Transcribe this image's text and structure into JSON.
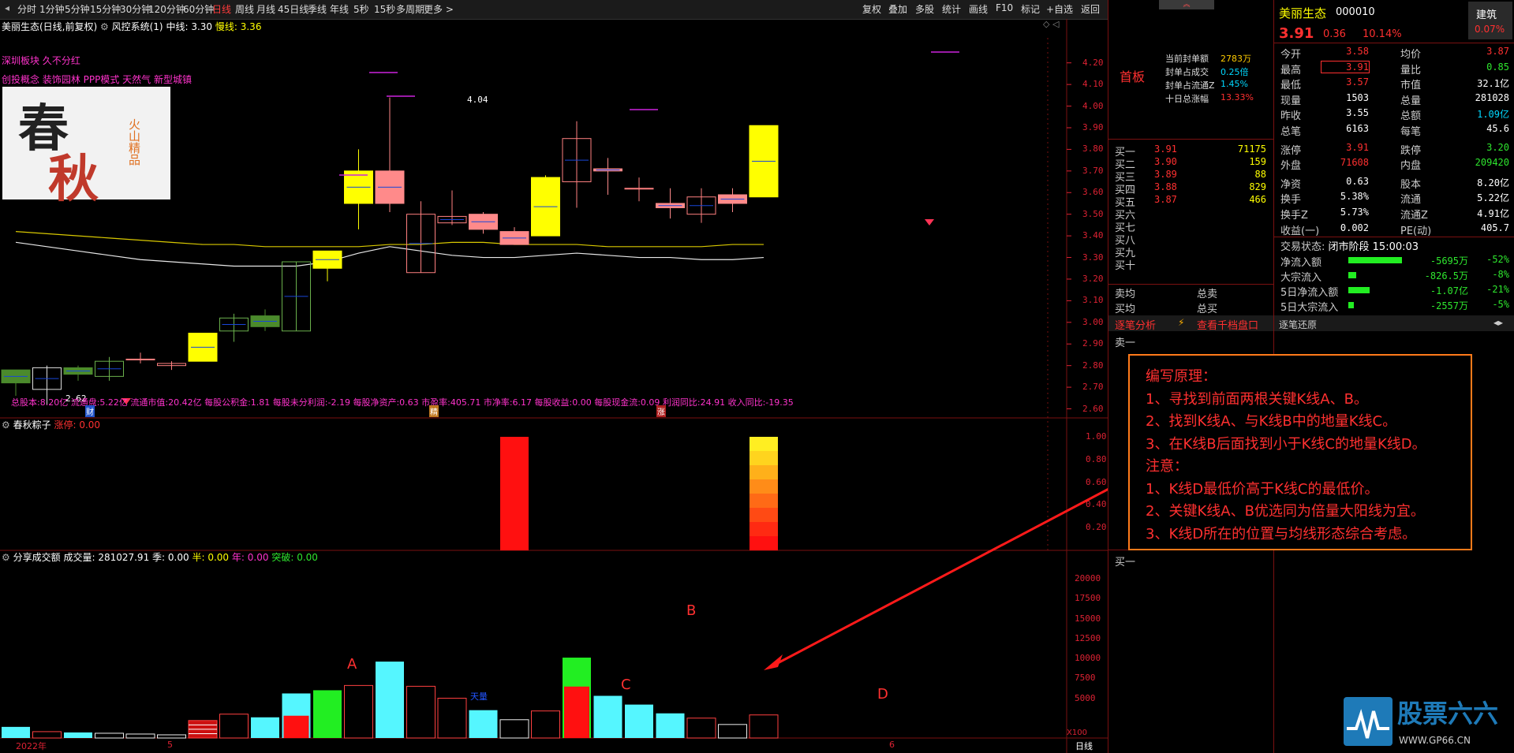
{
  "toolbar": {
    "periods": [
      "分时",
      "1分钟",
      "5分钟",
      "15分钟",
      "30分钟",
      "120分钟",
      "60分钟",
      "日线",
      "周线",
      "月线",
      "45日线",
      "季线",
      "年线",
      "5秒",
      "15秒",
      "多周期",
      "更多 >"
    ],
    "active_period": "日线",
    "right_buttons": [
      "复权",
      "叠加",
      "多股",
      "统计",
      "画线",
      "F10",
      "标记",
      "+自选",
      "返回"
    ]
  },
  "chart": {
    "title": "美丽生态(日线,前复权)",
    "indicator": "风控系统(1)",
    "mid_label": "中线:",
    "mid_value": "3.30",
    "slow_label": "慢线:",
    "slow_value": "3.36",
    "tags_line1": "深圳板块  久不分红",
    "tags_line2": "创投概念  装饰园林  PPP模式  天然气  新型城镇",
    "logo_text_1": "春",
    "logo_text_2": "秋",
    "logo_sub": "火山精品",
    "peak_label": "4.04",
    "low_label": "2.62",
    "price_ticks": [
      "4.20",
      "4.10",
      "4.00",
      "3.90",
      "3.80",
      "3.70",
      "3.60",
      "3.50",
      "3.40",
      "3.30",
      "3.20",
      "3.10",
      "3.00",
      "2.90",
      "2.80",
      "2.70",
      "2.60"
    ],
    "fin_line": "总股本:8.20亿  流通盘:5.22亿  流通市值:20.42亿  每股公积金:1.81  每股未分利润:-2.19  每股净资产:0.63  市盈率:405.71  市净率:6.17  每股收益:0.00  每股现金流:0.09  利润同比:24.91  收入同比:-19.35",
    "badge_cai": "财",
    "badge_jing": "精",
    "badge_zhang": "涨",
    "zongzi_title": "春秋粽子",
    "zongzi_label": "涨停:",
    "zongzi_value": "0.00",
    "zongzi_ticks": [
      "1.00",
      "0.80",
      "0.60",
      "0.40",
      "0.20"
    ],
    "vol_title": "分享成交额",
    "vol_label": "成交量:",
    "vol_value": "281027.91",
    "ji_label": "季:",
    "ji_value": "0.00",
    "ban_label": "半:",
    "ban_value": "0.00",
    "nian_label": "年:",
    "nian_value": "0.00",
    "tupo_label": "突破:",
    "tupo_value": "0.00",
    "vol_ticks": [
      "20000",
      "17500",
      "15000",
      "12500",
      "10000",
      "7500",
      "5000"
    ],
    "vol_unit": "X100",
    "x_labels": [
      "2022年",
      "5",
      "6"
    ],
    "x_period": "日线",
    "mark_A": "A",
    "mark_B": "B",
    "mark_C": "C",
    "mark_D": "D",
    "tianliang": "天量"
  },
  "annotation": {
    "lines": [
      "编写原理：",
      "1、寻找到前面两根关键K线A、B。",
      "2、找到K线A、与K线B中的地量K线C。",
      "3、在K线B后面找到小于K线C的地量K线D。",
      "注意：",
      "1、K线D最低价高于K线C的最低价。",
      "2、关键K线A、B优选同为倍量大阳线为宜。",
      "3、K线D所在的位置与均线形态综合考虑。"
    ]
  },
  "orderbook": {
    "title": "首板",
    "seal_rows": [
      {
        "label": "当前封单额",
        "value": "2783万"
      },
      {
        "label": "封单占成交",
        "value": "0.25倍"
      },
      {
        "label": "封单占流通Z",
        "value": "1.45%"
      },
      {
        "label": "十日总涨幅",
        "value": "13.33%"
      }
    ],
    "bids": [
      {
        "label": "买一",
        "price": "3.91",
        "vol": "71175"
      },
      {
        "label": "买二",
        "price": "3.90",
        "vol": "159"
      },
      {
        "label": "买三",
        "price": "3.89",
        "vol": "88"
      },
      {
        "label": "买四",
        "price": "3.88",
        "vol": "829"
      },
      {
        "label": "买五",
        "price": "3.87",
        "vol": "466"
      },
      {
        "label": "买六",
        "price": "",
        "vol": ""
      },
      {
        "label": "买七",
        "price": "",
        "vol": ""
      },
      {
        "label": "买八",
        "price": "",
        "vol": ""
      },
      {
        "label": "买九",
        "price": "",
        "vol": ""
      },
      {
        "label": "买十",
        "price": "",
        "vol": ""
      }
    ],
    "sell_avg": "卖均",
    "buy_avg": "买均",
    "total_sell": "总卖",
    "total_buy": "总买",
    "tick_analysis": "逐笔分析",
    "view_1000": "查看千档盘口",
    "sell1": "卖一",
    "buy1": "买一"
  },
  "quote": {
    "name": "美丽生态",
    "code": "000010",
    "sector": "建筑",
    "sector_pct": "0.07%",
    "price": "3.91",
    "change": "0.36",
    "change_pct": "10.14%",
    "rows": [
      {
        "l1": "今开",
        "v1": "3.58",
        "l2": "均价",
        "v2": "3.87"
      },
      {
        "l1": "最高",
        "v1": "3.91",
        "l2": "量比",
        "v2": "0.85"
      },
      {
        "l1": "最低",
        "v1": "3.57",
        "l2": "市值",
        "v2": "32.1亿"
      },
      {
        "l1": "现量",
        "v1": "1503",
        "l2": "总量",
        "v2": "281028"
      },
      {
        "l1": "昨收",
        "v1": "3.55",
        "l2": "总额",
        "v2": "1.09亿"
      },
      {
        "l1": "总笔",
        "v1": "6163",
        "l2": "每笔",
        "v2": "45.6"
      },
      {
        "l1": "涨停",
        "v1": "3.91",
        "l2": "跌停",
        "v2": "3.20"
      },
      {
        "l1": "外盘",
        "v1": "71608",
        "l2": "内盘",
        "v2": "209420"
      },
      {
        "l1": "净资",
        "v1": "0.63",
        "l2": "股本",
        "v2": "8.20亿"
      },
      {
        "l1": "换手",
        "v1": "5.38%",
        "l2": "流通",
        "v2": "5.22亿"
      },
      {
        "l1": "换手Z",
        "v1": "5.73%",
        "l2": "流通Z",
        "v2": "4.91亿"
      },
      {
        "l1": "收益(一)",
        "v1": "0.002",
        "l2": "PE(动)",
        "v2": "405.7"
      }
    ],
    "status_label": "交易状态:",
    "status_value": "闭市阶段 15:00:03",
    "flows": [
      {
        "label": "净流入额",
        "value": "-5695万",
        "pct": "-52%",
        "fill": 0.52
      },
      {
        "label": "大宗流入",
        "value": "-826.5万",
        "pct": "-8%",
        "fill": 0.08
      },
      {
        "label": "5日净流入额",
        "value": "-1.07亿",
        "pct": "-21%",
        "fill": 0.21
      },
      {
        "label": "5日大宗流入",
        "value": "-2557万",
        "pct": "-5%",
        "fill": 0.05
      }
    ],
    "tick_restore": "逐笔还原"
  },
  "watermark": {
    "brand": "股票六六",
    "url": "WWW.GP66.CN"
  },
  "colors": {
    "up": "#ff3030",
    "down": "#2ee62e",
    "yang_fill": "#ffff00",
    "yin_fill": "#ff8a8a",
    "green_candle": "#4b8a2c",
    "vol_cyan": "#55f6ff",
    "grid": "#7a1010"
  },
  "chart_data": {
    "type": "candlestick",
    "candles": [
      {
        "o": 2.72,
        "h": 2.77,
        "l": 2.66,
        "c": 2.78,
        "k": "green"
      },
      {
        "o": 2.79,
        "h": 2.8,
        "l": 2.62,
        "c": 2.69,
        "k": "hollow-white"
      },
      {
        "o": 2.79,
        "h": 2.8,
        "l": 2.73,
        "c": 2.76,
        "k": "green"
      },
      {
        "o": 2.75,
        "h": 2.84,
        "l": 2.73,
        "c": 2.82,
        "k": "hollow-green"
      },
      {
        "o": 2.83,
        "h": 2.86,
        "l": 2.81,
        "c": 2.83,
        "k": "doji"
      },
      {
        "o": 2.8,
        "h": 2.82,
        "l": 2.78,
        "c": 2.81,
        "k": "doji"
      },
      {
        "o": 2.82,
        "h": 2.95,
        "l": 2.82,
        "c": 2.95,
        "k": "yellow"
      },
      {
        "o": 3.02,
        "h": 3.04,
        "l": 2.91,
        "c": 2.96,
        "k": "hollow-green"
      },
      {
        "o": 3.03,
        "h": 3.06,
        "l": 2.96,
        "c": 2.98,
        "k": "green"
      },
      {
        "o": 2.96,
        "h": 3.28,
        "l": 2.96,
        "c": 3.28,
        "k": "hollow-green"
      },
      {
        "o": 3.25,
        "h": 3.33,
        "l": 3.19,
        "c": 3.33,
        "k": "yellow"
      },
      {
        "o": 3.55,
        "h": 3.8,
        "l": 3.43,
        "c": 3.7,
        "k": "yellow"
      },
      {
        "o": 3.7,
        "h": 4.04,
        "l": 3.51,
        "c": 3.55,
        "k": "pink"
      },
      {
        "o": 3.5,
        "h": 3.56,
        "l": 3.23,
        "c": 3.23,
        "k": "hollow-pink"
      },
      {
        "o": 3.49,
        "h": 3.61,
        "l": 3.45,
        "c": 3.46,
        "k": "hollow-pink"
      },
      {
        "o": 3.43,
        "h": 3.51,
        "l": 3.41,
        "c": 3.5,
        "k": "pink"
      },
      {
        "o": 3.42,
        "h": 3.44,
        "l": 3.36,
        "c": 3.36,
        "k": "pink"
      },
      {
        "o": 3.4,
        "h": 3.68,
        "l": 3.4,
        "c": 3.67,
        "k": "yellow"
      },
      {
        "o": 3.65,
        "h": 3.93,
        "l": 3.53,
        "c": 3.85,
        "k": "hollow-pink"
      },
      {
        "o": 3.71,
        "h": 3.76,
        "l": 3.59,
        "c": 3.7,
        "k": "pink"
      },
      {
        "o": 3.62,
        "h": 3.67,
        "l": 3.56,
        "c": 3.62,
        "k": "doji"
      },
      {
        "o": 3.55,
        "h": 3.62,
        "l": 3.48,
        "c": 3.53,
        "k": "pink"
      },
      {
        "o": 3.58,
        "h": 3.62,
        "l": 3.46,
        "c": 3.5,
        "k": "hollow-pink"
      },
      {
        "o": 3.55,
        "h": 3.62,
        "l": 3.51,
        "c": 3.59,
        "k": "pink"
      },
      {
        "o": 3.58,
        "h": 3.91,
        "l": 3.58,
        "c": 3.91,
        "k": "yellow"
      }
    ],
    "mid_line": [
      3.42,
      3.41,
      3.4,
      3.39,
      3.38,
      3.37,
      3.36,
      3.36,
      3.35,
      3.35,
      3.35,
      3.35,
      3.36,
      3.36,
      3.37,
      3.37,
      3.36,
      3.36,
      3.36,
      3.35,
      3.35,
      3.35,
      3.35,
      3.36,
      3.36
    ],
    "slow_line": [
      3.37,
      3.35,
      3.33,
      3.31,
      3.29,
      3.28,
      3.27,
      3.26,
      3.26,
      3.26,
      3.28,
      3.32,
      3.35,
      3.33,
      3.31,
      3.3,
      3.3,
      3.31,
      3.32,
      3.31,
      3.3,
      3.3,
      3.29,
      3.29,
      3.3
    ],
    "volume": [
      1400,
      800,
      700,
      600,
      500,
      400,
      2200,
      3000,
      2600,
      5600,
      6000,
      6600,
      9600,
      6500,
      5000,
      3500,
      2300,
      3400,
      10100,
      5300,
      4200,
      3100,
      2500,
      1700,
      2900
    ],
    "volume_kind": [
      "cyan",
      "red",
      "cyan",
      "white",
      "white",
      "white",
      "stripe",
      "red",
      "cyan",
      "cyan-red",
      "green",
      "red",
      "cyan",
      "red",
      "red",
      "cyan",
      "white",
      "red",
      "green-red",
      "cyan",
      "cyan",
      "cyan",
      "red",
      "white",
      "red"
    ],
    "zongzi": [
      0,
      0,
      0,
      0,
      0,
      0,
      0,
      0,
      0,
      0,
      0,
      0,
      0,
      0,
      0,
      0,
      1,
      0,
      0,
      0,
      0,
      0,
      0,
      0,
      1
    ],
    "ylim": [
      2.58,
      4.25
    ],
    "vol_ylim": [
      0,
      21000
    ]
  }
}
